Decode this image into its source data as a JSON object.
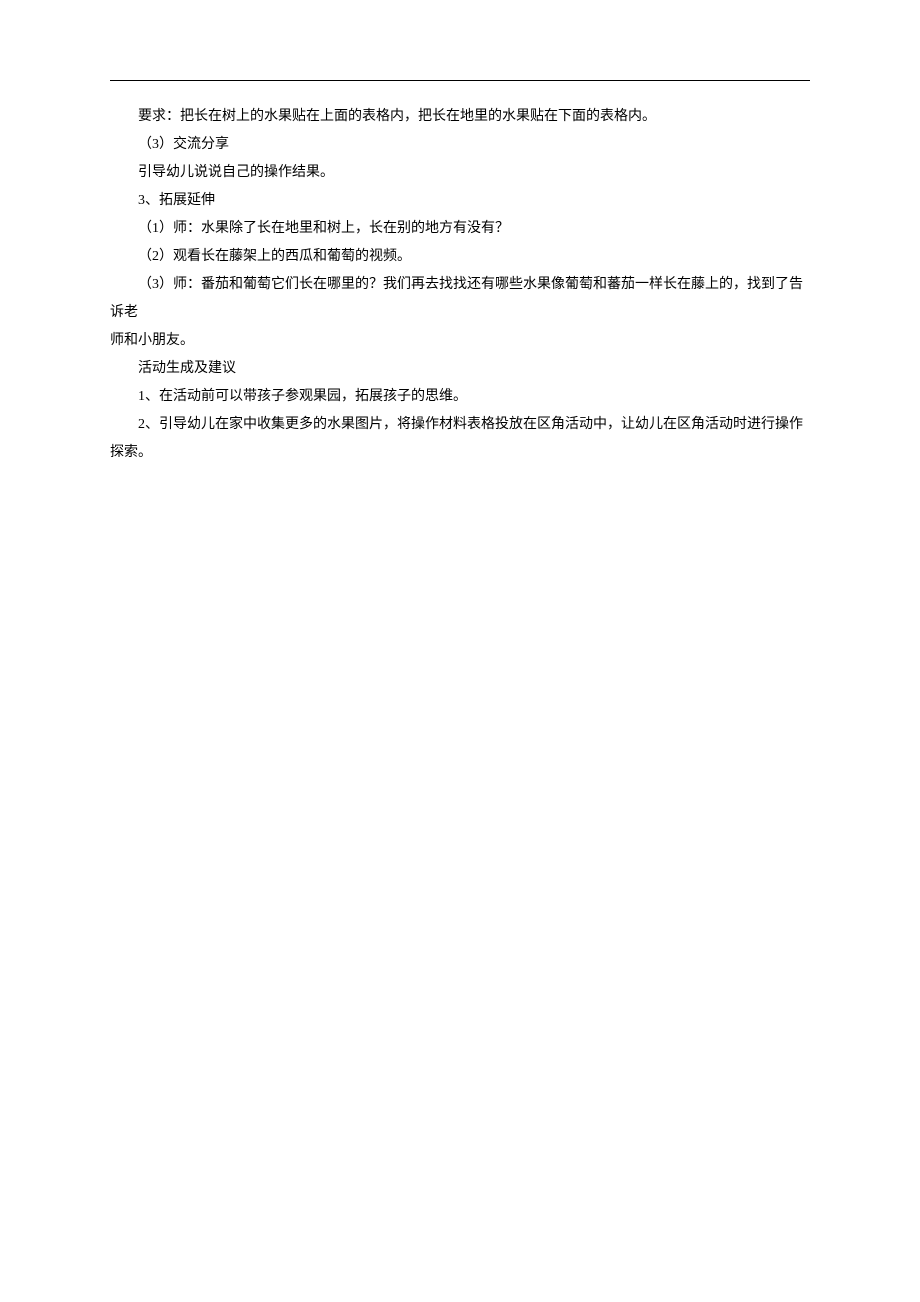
{
  "lines": [
    "要求：把长在树上的水果贴在上面的表格内，把长在地里的水果贴在下面的表格内。",
    "（3）交流分享",
    "引导幼儿说说自己的操作结果。",
    "3、拓展延伸",
    "（1）师：水果除了长在地里和树上，长在别的地方有没有？",
    "（2）观看长在藤架上的西瓜和葡萄的视频。",
    "（3）师：番茄和葡萄它们长在哪里的？我们再去找找还有哪些水果像葡萄和蕃茄一样长在藤上的，找到了告诉老",
    "师和小朋友。",
    "活动生成及建议",
    "1、在活动前可以带孩子参观果园，拓展孩子的思维。",
    "2、引导幼儿在家中收集更多的水果图片，将操作材料表格投放在区角活动中，让幼儿在区角活动时进行操作探索。"
  ]
}
